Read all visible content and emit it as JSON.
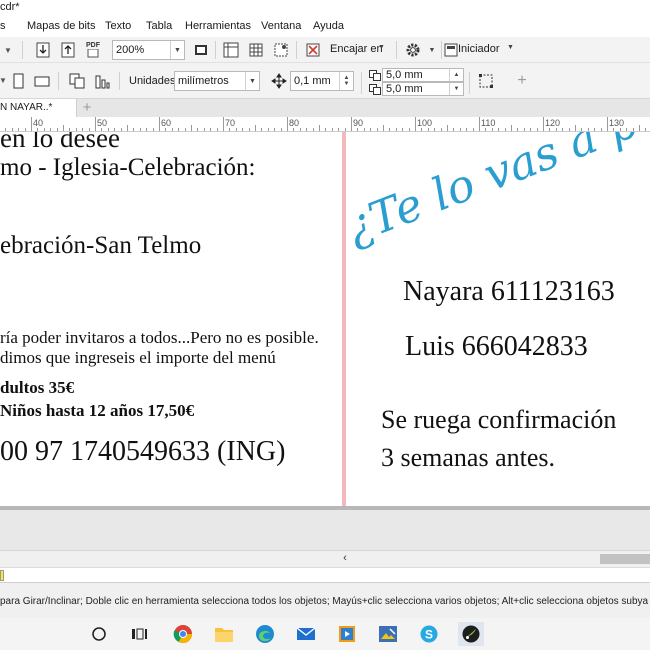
{
  "window": {
    "title": "cdr*"
  },
  "menu": [
    "Mapas de bits",
    "Texto",
    "Tabla",
    "Herramientas",
    "Ventana",
    "Ayuda"
  ],
  "toolbar": {
    "pdf_label": "PDF",
    "zoom_value": "200%",
    "snap_label": "Encajar en",
    "launcher_label": "Iniciador"
  },
  "propertybar": {
    "units_label": "Unidades:",
    "units_value": "milímetros",
    "nudge_value": "0,1 mm",
    "dup_x_value": "5,0 mm",
    "dup_y_value": "5,0 mm"
  },
  "tabs": {
    "document_tab": "N NAYAR..*"
  },
  "ruler": {
    "labels": [
      "40",
      "50",
      "60",
      "70",
      "80",
      "90",
      "100",
      "110",
      "120",
      "130"
    ]
  },
  "page": {
    "left": {
      "line1": "en lo desee",
      "line2": "mo - Iglesia-Celebración:",
      "line3": "ebración-San Telmo",
      "line4": "ría poder invitaros a todos...Pero no es posible.",
      "line5": "dimos que ingreseis el importe del menú",
      "line6": "dultos 35€",
      "line7": "Niños hasta 12 años 17,50€",
      "line8": "00 97 1740549633 (ING)"
    },
    "right": {
      "script_text": "¿Te lo vas a perder?",
      "contact1": "Nayara 611123163",
      "contact2": "Luis 666042833",
      "note1": "Se ruega confirmación",
      "note2": "3 semanas antes."
    }
  },
  "statusbar": {
    "hint": "para Girar/Inclinar; Doble clic en herramienta selecciona todos los objetos; Mayús+clic selecciona varios objetos; Alt+clic selecciona objetos subya"
  },
  "taskbar": {
    "icons": [
      "search-circle-icon",
      "task-view-icon",
      "chrome-icon",
      "file-explorer-icon",
      "edge-icon",
      "mail-icon",
      "media-player-icon",
      "photo-app-icon",
      "skype-icon",
      "coreldraw-icon"
    ]
  },
  "colors": {
    "script_text": "#2a9ed0",
    "page_divider": "#f3b9bd",
    "taskbar_bg": "#f4f4f4"
  }
}
